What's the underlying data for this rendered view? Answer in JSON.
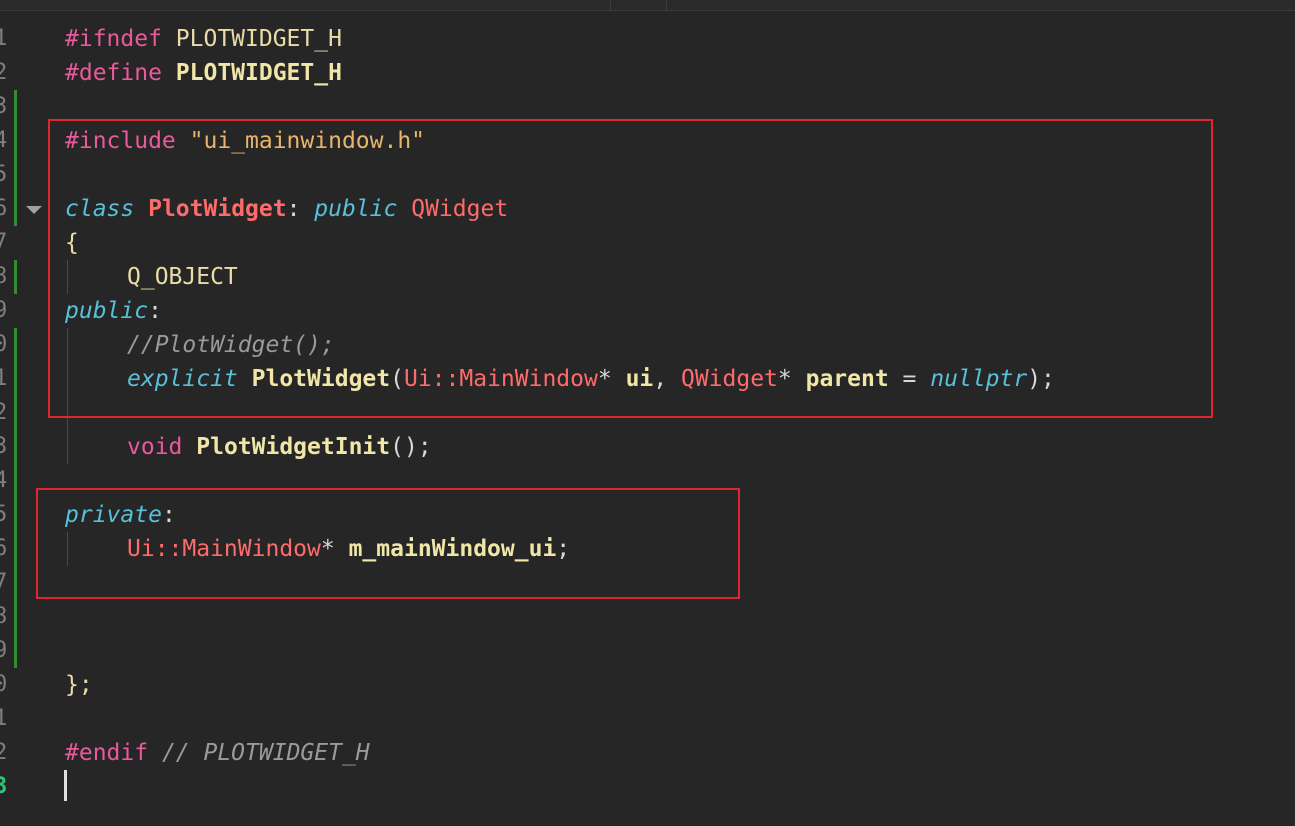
{
  "editor": {
    "line_numbers": [
      "1",
      "2",
      "3",
      "4",
      "5",
      "6",
      "7",
      "8",
      "9",
      "0",
      "1",
      "2",
      "3",
      "4",
      "5",
      "6",
      "7",
      "8",
      "9",
      "0",
      "1",
      "2",
      "3"
    ],
    "code": {
      "l1_directive": "#ifndef",
      "l1_macro": " PLOTWIDGET_H",
      "l2_directive": "#define",
      "l2_macro": " PLOTWIDGET_H",
      "l4_directive": "#include",
      "l4_string": " \"ui_mainwindow.h\"",
      "l6_class_kw": "class",
      "l6_class_name": "PlotWidget",
      "l6_colon": ": ",
      "l6_public_kw": "public",
      "l6_base": " QWidget",
      "l7_brace": "{",
      "l8_macro": "Q_OBJECT",
      "l9_access": "public",
      "l9_colon": ":",
      "l10_comment": "//PlotWidget();",
      "l11_explicit": "explicit",
      "l11_fn": "PlotWidget",
      "l11_paren_open": "(",
      "l11_type1": "Ui::MainWindow",
      "l11_star1": "* ",
      "l11_param1": "ui",
      "l11_comma": ", ",
      "l11_type2": "QWidget",
      "l11_star2": "* ",
      "l11_param2": "parent",
      "l11_eq": " = ",
      "l11_null": "nullptr",
      "l11_end": ");",
      "l13_void": "void",
      "l13_fn": "PlotWidgetInit",
      "l13_end": "();",
      "l15_access": "private",
      "l15_colon": ":",
      "l16_type": "Ui::MainWindow",
      "l16_star": "* ",
      "l16_member": "m_mainWindow_ui",
      "l16_end": ";",
      "l20_close": "};",
      "l22_directive": "#endif",
      "l22_comment": " // PLOTWIDGET_H"
    },
    "colors": {
      "background": "#262626",
      "keyword": "#e85a9b",
      "italic_keyword": "#58c0d8",
      "function": "#f0e6a8",
      "type": "#ff6b6b",
      "string": "#e8b56a",
      "comment": "#9a9a9a",
      "highlight_box": "#e0252f",
      "modified_marker": "#2f8f2f",
      "current_line_number": "#2ec47a"
    }
  }
}
